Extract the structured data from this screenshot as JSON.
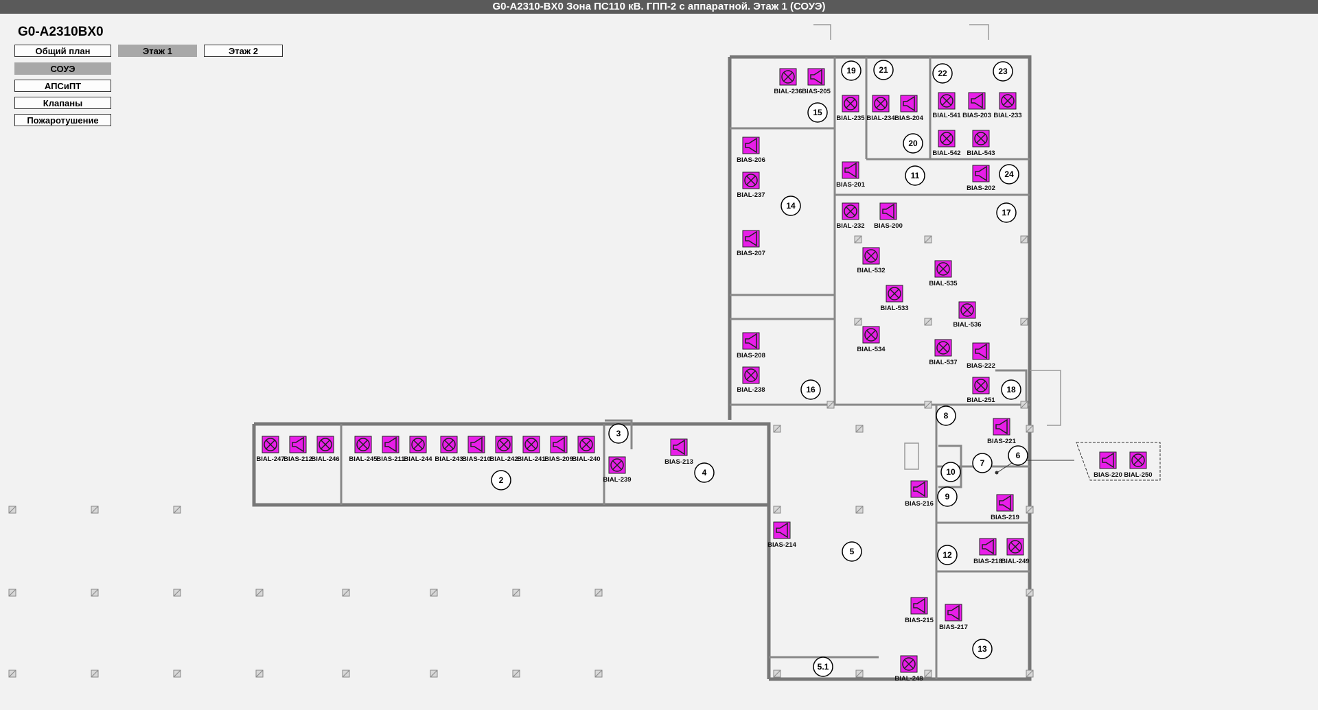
{
  "window": {
    "title": "G0-A2310-BX0 Зона ПС110 кВ. ГПП-2 с аппаратной. Этаж 1 (СОУЭ)"
  },
  "station_label": "G0-A2310BX0",
  "nav": {
    "general_plan": "Общий план",
    "floor1": "Этаж 1",
    "floor2": "Этаж 2",
    "soue": "СОУЭ",
    "apsipt": "АПСиПТ",
    "valves": "Клапаны",
    "firefighting": "Пожаротушение"
  },
  "colors": {
    "device_fill": "#e81ee8",
    "titlebar": "#5a5a5a",
    "active_button": "#a8a8a8"
  },
  "rooms": [
    "2",
    "3",
    "4",
    "5",
    "5.1",
    "6",
    "7",
    "8",
    "9",
    "10",
    "11",
    "12",
    "13",
    "14",
    "15",
    "16",
    "17",
    "18",
    "19",
    "20",
    "21",
    "22",
    "23",
    "24"
  ],
  "devices": [
    {
      "label": "BIAL-236",
      "type": "lamp"
    },
    {
      "label": "BIAS-205",
      "type": "speaker"
    },
    {
      "label": "BIAL-235",
      "type": "lamp"
    },
    {
      "label": "BIAL-234",
      "type": "lamp"
    },
    {
      "label": "BIAS-204",
      "type": "speaker"
    },
    {
      "label": "BIAL-541",
      "type": "lamp"
    },
    {
      "label": "BIAS-203",
      "type": "speaker"
    },
    {
      "label": "BIAL-233",
      "type": "lamp"
    },
    {
      "label": "BIAL-542",
      "type": "lamp"
    },
    {
      "label": "BIAL-543",
      "type": "lamp"
    },
    {
      "label": "BIAS-206",
      "type": "speaker"
    },
    {
      "label": "BIAL-237",
      "type": "lamp"
    },
    {
      "label": "BIAS-207",
      "type": "speaker"
    },
    {
      "label": "BIAS-201",
      "type": "speaker"
    },
    {
      "label": "BIAS-202",
      "type": "speaker"
    },
    {
      "label": "BIAL-232",
      "type": "lamp"
    },
    {
      "label": "BIAS-200",
      "type": "speaker"
    },
    {
      "label": "BIAL-532",
      "type": "lamp"
    },
    {
      "label": "BIAL-535",
      "type": "lamp"
    },
    {
      "label": "BIAL-533",
      "type": "lamp"
    },
    {
      "label": "BIAL-536",
      "type": "lamp"
    },
    {
      "label": "BIAL-534",
      "type": "lamp"
    },
    {
      "label": "BIAL-537",
      "type": "lamp"
    },
    {
      "label": "BIAS-222",
      "type": "speaker"
    },
    {
      "label": "BIAS-208",
      "type": "speaker"
    },
    {
      "label": "BIAL-238",
      "type": "lamp"
    },
    {
      "label": "BIAL-251",
      "type": "lamp"
    },
    {
      "label": "BIAS-221",
      "type": "speaker"
    },
    {
      "label": "BIAL-247",
      "type": "lamp"
    },
    {
      "label": "BIAS-212",
      "type": "speaker"
    },
    {
      "label": "BIAL-246",
      "type": "lamp"
    },
    {
      "label": "BIAL-245",
      "type": "lamp"
    },
    {
      "label": "BIAS-211",
      "type": "speaker"
    },
    {
      "label": "BIAL-244",
      "type": "lamp"
    },
    {
      "label": "BIAL-243",
      "type": "lamp"
    },
    {
      "label": "BIAS-210",
      "type": "speaker"
    },
    {
      "label": "BIAL-242",
      "type": "lamp"
    },
    {
      "label": "BIAL-241",
      "type": "lamp"
    },
    {
      "label": "BIAS-209",
      "type": "speaker"
    },
    {
      "label": "BIAL-240",
      "type": "lamp"
    },
    {
      "label": "BIAL-239",
      "type": "lamp"
    },
    {
      "label": "BIAS-213",
      "type": "speaker"
    },
    {
      "label": "BIAS-220",
      "type": "speaker"
    },
    {
      "label": "BIAL-250",
      "type": "lamp"
    },
    {
      "label": "BIAS-216",
      "type": "speaker"
    },
    {
      "label": "BIAS-219",
      "type": "speaker"
    },
    {
      "label": "BIAS-214",
      "type": "speaker"
    },
    {
      "label": "BIAS-218",
      "type": "speaker"
    },
    {
      "label": "BIAL-249",
      "type": "lamp"
    },
    {
      "label": "BIAS-215",
      "type": "speaker"
    },
    {
      "label": "BIAS-217",
      "type": "speaker"
    },
    {
      "label": "BIAL-248",
      "type": "lamp"
    }
  ]
}
